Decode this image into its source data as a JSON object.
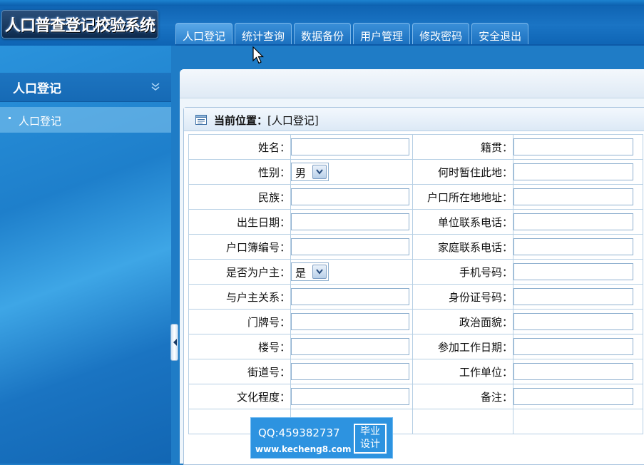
{
  "app": {
    "title": "人口普查登记校验系统"
  },
  "nav": {
    "tabs": [
      {
        "label": "人口登记"
      },
      {
        "label": "统计查询"
      },
      {
        "label": "数据备份"
      },
      {
        "label": "用户管理"
      },
      {
        "label": "修改密码"
      },
      {
        "label": "安全退出"
      }
    ]
  },
  "sidebar": {
    "title": "人口登记",
    "items": [
      {
        "label": "人口登记"
      }
    ]
  },
  "panel": {
    "breadcrumb_prefix": "当前位置：",
    "breadcrumb_value": "[人口登记]"
  },
  "form": {
    "rows": [
      {
        "left_label": "姓名：",
        "right_label": "籍贯："
      },
      {
        "left_label": "性别：",
        "left_select": "男",
        "right_label": "何时暂住此地："
      },
      {
        "left_label": "民族：",
        "right_label": "户口所在地地址："
      },
      {
        "left_label": "出生日期：",
        "right_label": "单位联系电话："
      },
      {
        "left_label": "户口簿编号：",
        "right_label": "家庭联系电话："
      },
      {
        "left_label": "是否为户主：",
        "left_select": "是",
        "right_label": "手机号码："
      },
      {
        "left_label": "与户主关系：",
        "right_label": "身份证号码："
      },
      {
        "left_label": "门牌号：",
        "right_label": "政治面貌："
      },
      {
        "left_label": "楼号：",
        "right_label": "参加工作日期："
      },
      {
        "left_label": "街道号：",
        "right_label": "工作单位："
      },
      {
        "left_label": "文化程度：",
        "right_label": "备注："
      }
    ]
  },
  "watermark": {
    "qq": "QQ:459382737",
    "url": "www.kecheng8.com",
    "badge_line1": "毕业",
    "badge_line2": "设计"
  },
  "icons": {
    "collapse": "double-chevron-down-icon",
    "document": "document-icon",
    "dropdown": "chevron-down-icon",
    "splitter": "arrow-left-icon",
    "cursor": "mouse-pointer-icon"
  },
  "colors": {
    "header": "#1a74c4",
    "sidebar": "#1e7fcb",
    "panel_border": "#a7c3de",
    "watermark": "#2d93e0"
  }
}
